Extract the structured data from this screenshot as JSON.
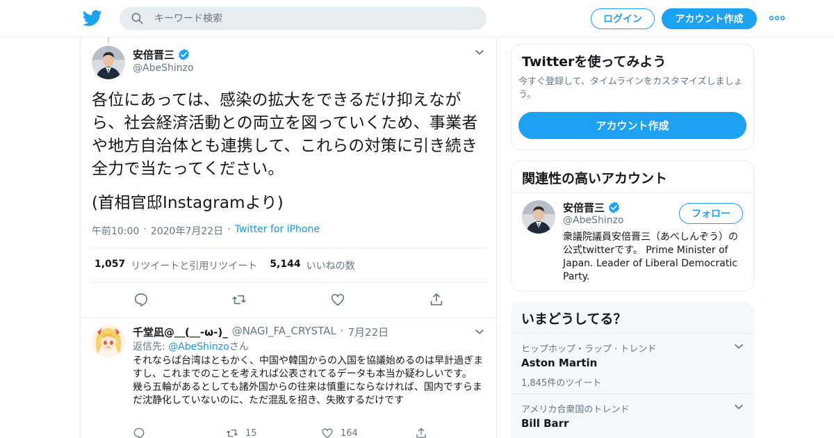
{
  "header": {
    "search_placeholder": "キーワード検索",
    "login_label": "ログイン",
    "signup_label": "アカウント作成"
  },
  "tweet": {
    "author_name": "安倍晋三",
    "author_handle": "@AbeShinzo",
    "text_main": "各位にあっては、感染の拡大をできるだけ抑えながら、社会経済活動との両立を図っていくため、事業者や地方自治体とも連携して、これらの対策に引き続き全力で当たってください。",
    "text_source": "(首相官邸Instagramより)",
    "time": "午前10:00",
    "date": "2020年7月22日",
    "client": "Twitter for iPhone",
    "retweet_count": "1,057",
    "retweet_label": "リツイートと引用リツイート",
    "like_count": "5,144",
    "like_label": "いいねの数"
  },
  "reply": {
    "author_name": "千堂凪@＿(＿-ω-)_",
    "author_handle": "@NAGI_FA_CRYSTAL",
    "date": "7月22日",
    "replying_to_label": "返信先:",
    "replying_to_handle": "@AbeShinzo",
    "replying_to_suffix": "さん",
    "text": "それならば台湾はともかく、中国や韓国からの入国を協議始めるのは早計過ぎますし、これまでのことを考えれば公表されてるデータも本当か疑わしいです。\n幾ら五輪があるとしても諸外国からの往来は慎重にならなければ、国内ですらまだ沈静化していないのに、ただ混乱を招き、失敗するだけです",
    "retweets": "15",
    "likes": "164"
  },
  "sidebar": {
    "signup_card": {
      "title": "Twitterを使ってみよう",
      "description": "今すぐ登録して、タイムラインをカスタマイズしましょう。",
      "button_label": "アカウント作成"
    },
    "related_card": {
      "title": "関連性の高いアカウント",
      "name": "安倍晋三",
      "handle": "@AbeShinzo",
      "follow_label": "フォロー",
      "bio": "衆議院議員安倍晋三（あべしんぞう）の公式twitterです。 Prime Minister of Japan. Leader of Liberal Democratic Party."
    },
    "trends_card": {
      "title": "いまどうしてる？",
      "trends": [
        {
          "context": "ヒップホップ・ラップ · トレンド",
          "name": "Aston Martin",
          "count": "1,845件のツイート"
        },
        {
          "context": "アメリカ合衆国のトレンド",
          "name": "Bill Barr",
          "count": ""
        }
      ]
    }
  },
  "colors": {
    "accent": "#1da1f2",
    "link": "#1b95e0",
    "secondary_text": "#657786",
    "border": "#e6ecf0"
  }
}
